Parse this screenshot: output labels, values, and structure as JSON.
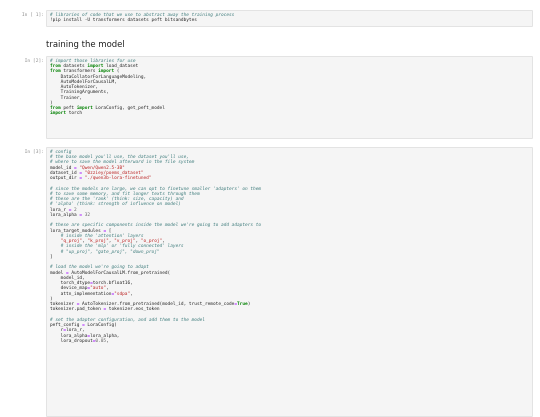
{
  "cells": [
    {
      "prompt": "In [ 1]:",
      "lines": [
        [
          [
            "c",
            "# libraries of code that we use to abstract away the training process"
          ]
        ],
        [
          [
            "t",
            "!pip install -U transformers datasets peft bitsandbytes"
          ]
        ]
      ]
    },
    {
      "prompt": "In [2]:",
      "lines": [
        [
          [
            "c",
            "# import those libraries for use"
          ]
        ],
        [
          [
            "k",
            "from"
          ],
          [
            "t",
            " datasets "
          ],
          [
            "k",
            "import"
          ],
          [
            "t",
            " load_dataset"
          ]
        ],
        [
          [
            "k",
            "from"
          ],
          [
            "t",
            " transformers "
          ],
          [
            "k",
            "import"
          ],
          [
            "t",
            " ("
          ]
        ],
        [
          [
            "t",
            "    DataCollatorForLanguageModeling,"
          ]
        ],
        [
          [
            "t",
            "    AutoModelForCausalLM,"
          ]
        ],
        [
          [
            "t",
            "    AutoTokenizer,"
          ]
        ],
        [
          [
            "t",
            "    TrainingArguments,"
          ]
        ],
        [
          [
            "t",
            "    Trainer,"
          ]
        ],
        [
          [
            "t",
            ")"
          ]
        ],
        [
          [
            "k",
            "from"
          ],
          [
            "t",
            " peft "
          ],
          [
            "k",
            "import"
          ],
          [
            "t",
            " LoraConfig, get_peft_model"
          ]
        ],
        [
          [
            "k",
            "import"
          ],
          [
            "t",
            " torch"
          ]
        ]
      ]
    },
    {
      "prompt": "In [3]:",
      "lines": [
        [
          [
            "c",
            "# config"
          ]
        ],
        [
          [
            "c",
            "# the base model you'll use, the dataset you'll use,"
          ]
        ],
        [
          [
            "c",
            "# where to save the model afterward in the file system"
          ]
        ],
        [
          [
            "t",
            "model_id "
          ],
          [
            "o",
            "="
          ],
          [
            "t",
            " "
          ],
          [
            "s",
            "\"Qwen/Qwen2.5-3B\""
          ]
        ],
        [
          [
            "t",
            "dataset_id "
          ],
          [
            "o",
            "="
          ],
          [
            "t",
            " "
          ],
          [
            "s",
            "\"0zziey/poems_dataset\""
          ]
        ],
        [
          [
            "t",
            "output_dir "
          ],
          [
            "o",
            "="
          ],
          [
            "t",
            " "
          ],
          [
            "s",
            "\"./qwen3b-lora-finetuned\""
          ]
        ],
        [
          [
            "t",
            ""
          ]
        ],
        [
          [
            "c",
            "# since the models are large, we can opt to finetune smaller 'adapters' on them"
          ]
        ],
        [
          [
            "c",
            "# to save some memory, and fit longer texts through them"
          ]
        ],
        [
          [
            "c",
            "# these are the 'rank' (think: size, capacity) and"
          ]
        ],
        [
          [
            "c",
            "# 'alpha' (think: strength of influence on model)"
          ]
        ],
        [
          [
            "t",
            "lora_r "
          ],
          [
            "o",
            "="
          ],
          [
            "t",
            " "
          ],
          [
            "n",
            "2"
          ]
        ],
        [
          [
            "t",
            "lora_alpha "
          ],
          [
            "o",
            "="
          ],
          [
            "t",
            " "
          ],
          [
            "n",
            "32"
          ]
        ],
        [
          [
            "t",
            ""
          ]
        ],
        [
          [
            "c",
            "# these are specific components inside the model we're going to add adapters to"
          ]
        ],
        [
          [
            "t",
            "lora_target_modules "
          ],
          [
            "o",
            "="
          ],
          [
            "t",
            " ["
          ]
        ],
        [
          [
            "t",
            "    "
          ],
          [
            "c",
            "# inside the 'attention' layers"
          ]
        ],
        [
          [
            "t",
            "    "
          ],
          [
            "s",
            "\"q_proj\""
          ],
          [
            "t",
            ", "
          ],
          [
            "s",
            "\"k_proj\""
          ],
          [
            "t",
            ", "
          ],
          [
            "s",
            "\"v_proj\""
          ],
          [
            "t",
            ", "
          ],
          [
            "s",
            "\"o_proj\""
          ],
          [
            "t",
            ","
          ]
        ],
        [
          [
            "t",
            "    "
          ],
          [
            "c",
            "# inside the 'mlp' or 'fully connected' layers"
          ]
        ],
        [
          [
            "t",
            "    "
          ],
          [
            "c",
            "# \"up_proj\", \"gate_proj\", \"down_proj\""
          ]
        ],
        [
          [
            "t",
            "]"
          ]
        ],
        [
          [
            "t",
            ""
          ]
        ],
        [
          [
            "c",
            "# load the model we're going to adapt"
          ]
        ],
        [
          [
            "t",
            "model "
          ],
          [
            "o",
            "="
          ],
          [
            "t",
            " AutoModelForCausalLM.from_pretrained("
          ]
        ],
        [
          [
            "t",
            "    model_id,"
          ]
        ],
        [
          [
            "t",
            "    torch_dtype"
          ],
          [
            "o",
            "="
          ],
          [
            "t",
            "torch.bfloat16,"
          ]
        ],
        [
          [
            "t",
            "    device_map"
          ],
          [
            "o",
            "="
          ],
          [
            "s",
            "\"auto\""
          ],
          [
            "t",
            ","
          ]
        ],
        [
          [
            "t",
            "    attn_implementation"
          ],
          [
            "o",
            "="
          ],
          [
            "s",
            "\"sdpa\""
          ],
          [
            "t",
            ","
          ]
        ],
        [
          [
            "t",
            ")"
          ]
        ],
        [
          [
            "t",
            "tokenizer "
          ],
          [
            "o",
            "="
          ],
          [
            "t",
            " AutoTokenizer.from_pretrained(model_id, trust_remote_code"
          ],
          [
            "o",
            "="
          ],
          [
            "k",
            "True"
          ],
          [
            "t",
            ")"
          ]
        ],
        [
          [
            "t",
            "tokenizer.pad_token "
          ],
          [
            "o",
            "="
          ],
          [
            "t",
            " tokenizer.eos_token"
          ]
        ],
        [
          [
            "t",
            ""
          ]
        ],
        [
          [
            "c",
            "# set the adapter configuration, and add them to the model"
          ]
        ],
        [
          [
            "t",
            "peft_config "
          ],
          [
            "o",
            "="
          ],
          [
            "t",
            " LoraConfig("
          ]
        ],
        [
          [
            "t",
            "    r"
          ],
          [
            "o",
            "="
          ],
          [
            "t",
            "lora_r,"
          ]
        ],
        [
          [
            "t",
            "    lora_alpha"
          ],
          [
            "o",
            "="
          ],
          [
            "t",
            "lora_alpha,"
          ]
        ],
        [
          [
            "t",
            "    lora_dropout"
          ],
          [
            "o",
            "="
          ],
          [
            "n",
            "0.05"
          ],
          [
            "t",
            ","
          ]
        ]
      ]
    }
  ],
  "markdown": {
    "heading": "training the model"
  }
}
